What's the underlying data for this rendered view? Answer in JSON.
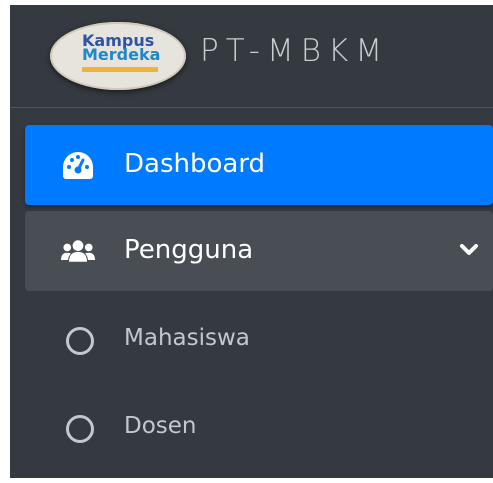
{
  "brand": {
    "logo_line1": "Kampus",
    "logo_line2": "Merdeka",
    "title": "PT-MBKM"
  },
  "sidebar": {
    "items": [
      {
        "label": "Dashboard",
        "icon": "tachometer-icon",
        "active": true
      },
      {
        "label": "Pengguna",
        "icon": "users-icon",
        "expanded": true,
        "children": [
          {
            "label": "Mahasiswa",
            "icon": "circle-icon"
          },
          {
            "label": "Dosen",
            "icon": "circle-icon"
          }
        ]
      }
    ]
  },
  "colors": {
    "sidebar_bg": "#343a40",
    "active_bg": "#007bff",
    "open_group_bg": "#494e54",
    "sub_text": "#c2c7d0"
  }
}
